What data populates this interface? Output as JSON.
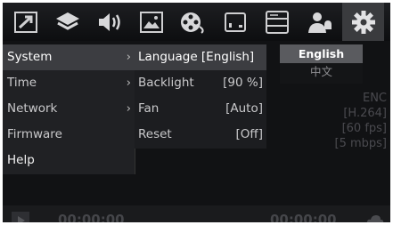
{
  "toolbar": {
    "icons": [
      "image-arrow-icon",
      "layers-icon",
      "speaker-icon",
      "picture-icon",
      "film-reel-icon",
      "card-icon",
      "storage-icon",
      "person-bell-icon",
      "gear-icon"
    ],
    "active": "gear-icon"
  },
  "main_menu": {
    "items": [
      {
        "label": "System",
        "arrow": "›",
        "selected": true
      },
      {
        "label": "Time",
        "arrow": "›"
      },
      {
        "label": "Network",
        "arrow": "›"
      },
      {
        "label": "Firmware",
        "arrow": ""
      },
      {
        "label": "Help",
        "arrow": ""
      }
    ]
  },
  "system_menu": {
    "items": [
      {
        "label": "Language [English]",
        "value": "",
        "selected": true
      },
      {
        "label": "Backlight",
        "value": "[90 %]"
      },
      {
        "label": "Fan",
        "value": "[Auto]"
      },
      {
        "label": "Reset",
        "value": "[Off]"
      }
    ]
  },
  "language_menu": {
    "options": [
      "English",
      "中文"
    ],
    "selected": "English"
  },
  "preview": {
    "enc_lines": [
      "ENC",
      "[H.264]",
      "[60 fps]",
      "[5 mbps]"
    ],
    "timecode_left": "00:00:00",
    "timecode_right": "00:00:00"
  },
  "colors": {
    "background": "#111214",
    "menu": "#202124",
    "selection": "#3c3d41",
    "language_selected": "#5a5b5f"
  }
}
